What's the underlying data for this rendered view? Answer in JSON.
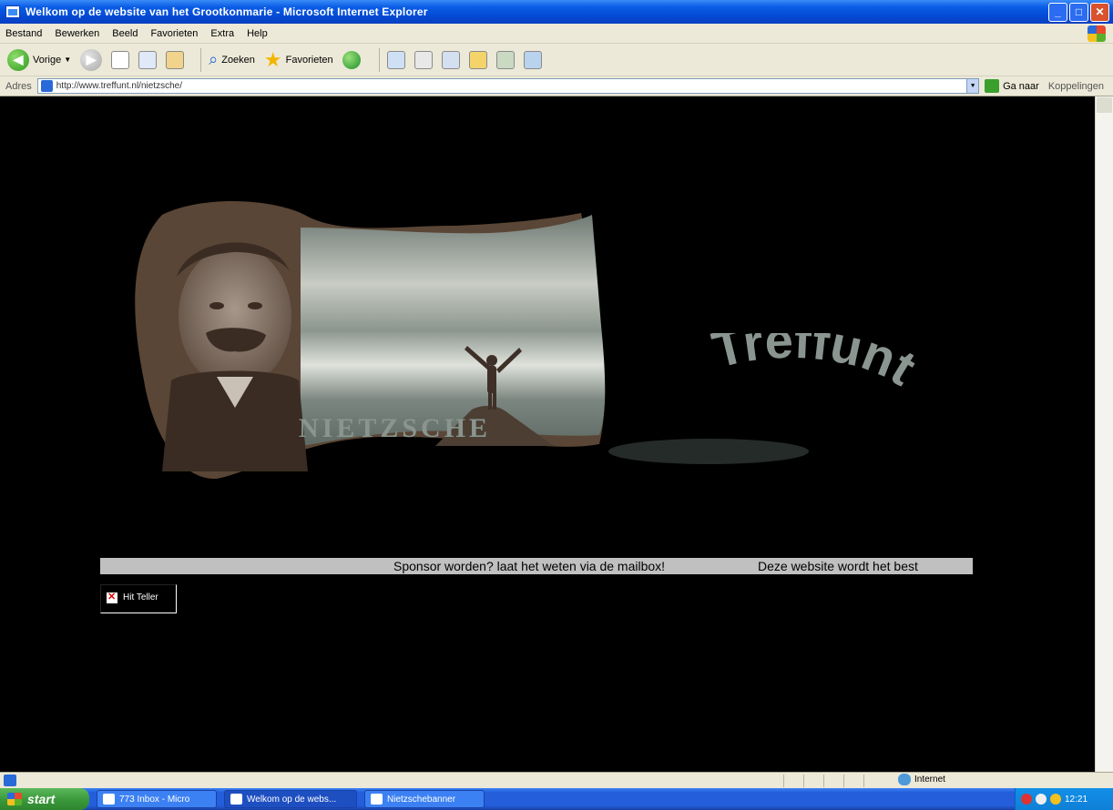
{
  "window": {
    "title": "Welkom op de website van het Grootkonmarie - Microsoft Internet Explorer",
    "buttons": [
      "minimize",
      "maximize",
      "close"
    ]
  },
  "menubar": {
    "items": [
      "Bestand",
      "Bewerken",
      "Beeld",
      "Favorieten",
      "Extra",
      "Help"
    ]
  },
  "toolbar": {
    "back_label": "Vorige",
    "search_label": "Zoeken",
    "favorites_label": "Favorieten"
  },
  "addressbar": {
    "label": "Adres",
    "url": "http://www.treffunt.nl/nietzsche/",
    "go_label": "Ga naar",
    "links_label": "Koppelingen"
  },
  "content": {
    "banner_caption": "NIETZSCHE",
    "logo_text": "Treffunt",
    "marquee_text_1": "Sponsor worden? laat het weten via de mailbox!",
    "marquee_text_2": "Deze website wordt het best",
    "broken_image_alt": "Hit Teller"
  },
  "statusbar": {
    "zone_label": "Internet"
  },
  "taskbar": {
    "start_label": "start",
    "tasks": [
      {
        "label": "773 Inbox - Micro"
      },
      {
        "label": "Welkom op de webs..."
      },
      {
        "label": "Nietzschebanner"
      }
    ],
    "clock": "12:21"
  },
  "colors": {
    "banner_brown": "#5a4636",
    "logo_grey": "#8a9590",
    "xp_blue": "#0a5ce6"
  }
}
